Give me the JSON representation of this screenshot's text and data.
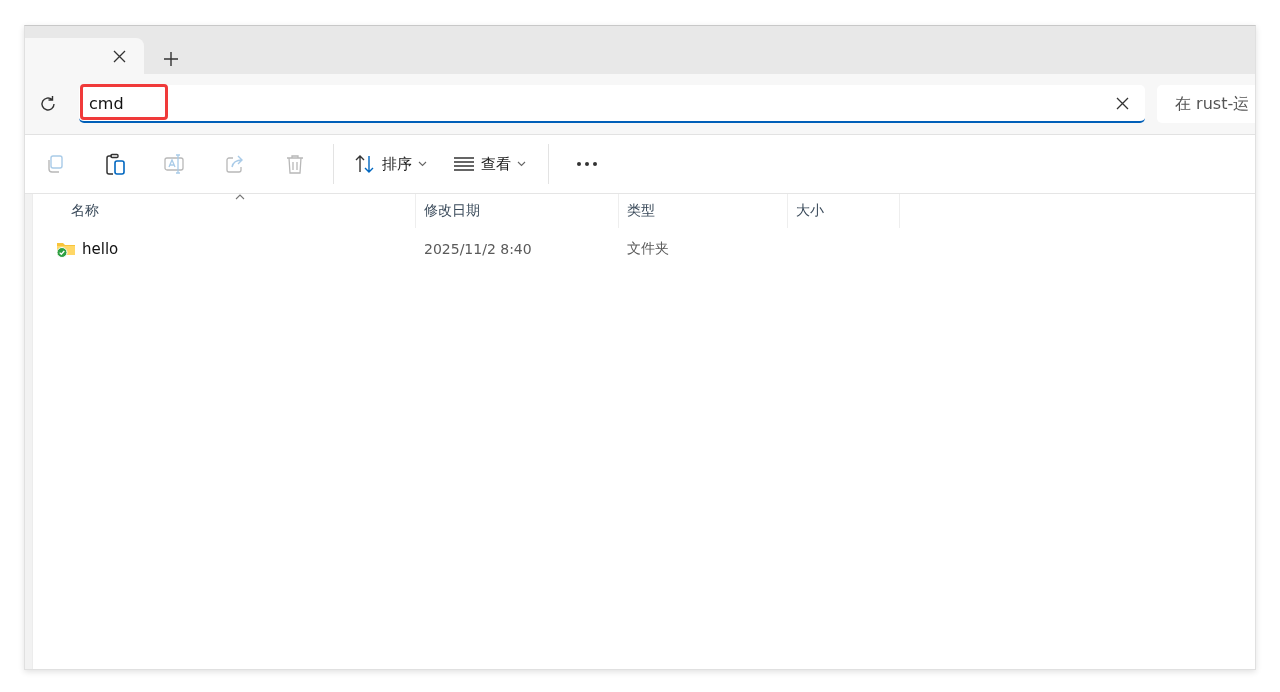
{
  "tab_bar": {
    "tabs": [
      {
        "selected": true
      }
    ]
  },
  "address_bar": {
    "value": "cmd",
    "focused": true,
    "highlighted": true,
    "search_placeholder": "在 rust-运"
  },
  "toolbar": {
    "items": [
      {
        "kind": "copy",
        "disabled": true
      },
      {
        "kind": "paste",
        "disabled": false
      },
      {
        "kind": "rename",
        "disabled": true
      },
      {
        "kind": "share",
        "disabled": true
      },
      {
        "kind": "delete",
        "disabled": true
      },
      {
        "kind": "sort",
        "label": "排序",
        "disabled": false
      },
      {
        "kind": "view",
        "label": "查看",
        "disabled": false
      },
      {
        "kind": "more",
        "disabled": false
      }
    ]
  },
  "table": {
    "columns": [
      "名称",
      "修改日期",
      "类型",
      "大小"
    ],
    "rows": [
      {
        "name": "hello",
        "modified": "2025/11/2 8:40",
        "type": "文件夹",
        "synced": true
      }
    ]
  }
}
